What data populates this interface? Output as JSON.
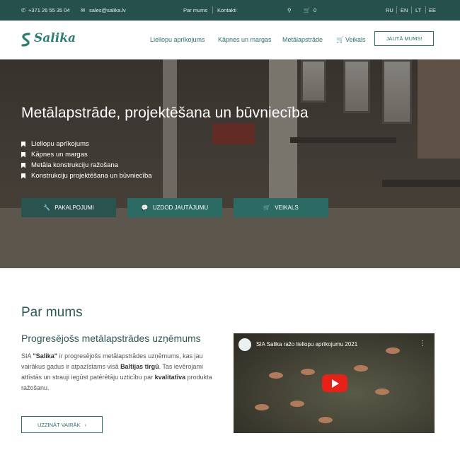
{
  "topbar": {
    "phone": "+371 26 55 35 04",
    "email": "sales@salika.lv",
    "links": [
      "Par mums",
      "Kontakti"
    ],
    "cart_count": "0",
    "languages": [
      "RU",
      "EN",
      "LT",
      "EE"
    ]
  },
  "navbar": {
    "brand": "Salika",
    "links": [
      "Liellopu aprīkojums",
      "Kāpnes un margas",
      "Metālapstrāde",
      "Veikals"
    ],
    "cta": "JAUTĀ MUMS!"
  },
  "hero": {
    "title": "Metālapstrāde, projektēšana un būvniecība",
    "items": [
      "Liellopu aprīkojums",
      "Kāpnes un margas",
      "Metāla konstrukciju ražošana",
      "Konstrukciju projektēšana un būvniecība"
    ],
    "buttons": [
      "PAKALPOJUMI",
      "UZDOD JAUTĀJUMU",
      "VEIKALS"
    ]
  },
  "about": {
    "title": "Par mums",
    "subtitle": "Progresējošs metālapstrādes uzņēmums",
    "text_parts": [
      "SIA ",
      "\"Salika\"",
      " ir progresējošs metālapstrādes uzņēmums, kas jau vairākus gadus ir atpazīstams visā ",
      "Baltijas tirgū",
      ". Tas ievērojami attīstās un strauji iegūst patērētāju uzticību par ",
      "kvalitatīva",
      " produkta ražošanu."
    ],
    "more_button": "UZZINĀT VAIRĀK",
    "video_title": "SIA Salika ražo liellopu aprīkojumu 2021"
  },
  "colors": {
    "topbar": "#26504c",
    "brand": "#2e7d73",
    "button": "#2b6b64",
    "youtube": "#e62117"
  }
}
